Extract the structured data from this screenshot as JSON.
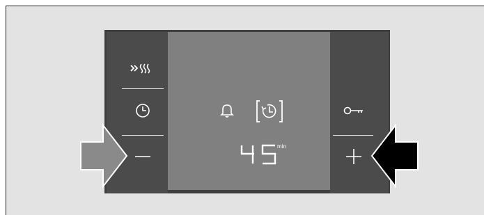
{
  "display": {
    "timer_value": "45",
    "timer_unit": "min"
  },
  "controls": {
    "left": [
      {
        "id": "fast-preheat",
        "icon": "fast-preheat-icon"
      },
      {
        "id": "time-setting",
        "icon": "clock-icon"
      },
      {
        "id": "minus",
        "icon": "minus-icon"
      }
    ],
    "right": [
      {
        "id": "childproof-lock",
        "icon": "key-icon"
      },
      {
        "id": "plus",
        "icon": "plus-icon"
      }
    ]
  },
  "display_icons": [
    "bell-icon",
    "timer-icon"
  ],
  "callouts": [
    {
      "target": "minus",
      "icon": "arrow-right-icon",
      "color": "#8a8a8a"
    },
    {
      "target": "plus",
      "icon": "arrow-left-icon",
      "color": "#000000"
    }
  ],
  "colors": {
    "background": "#e3e3e3",
    "panel": "#3f3f3f",
    "column": "#4b4b4b",
    "display": "#808080",
    "symbols": "#ffffff"
  }
}
